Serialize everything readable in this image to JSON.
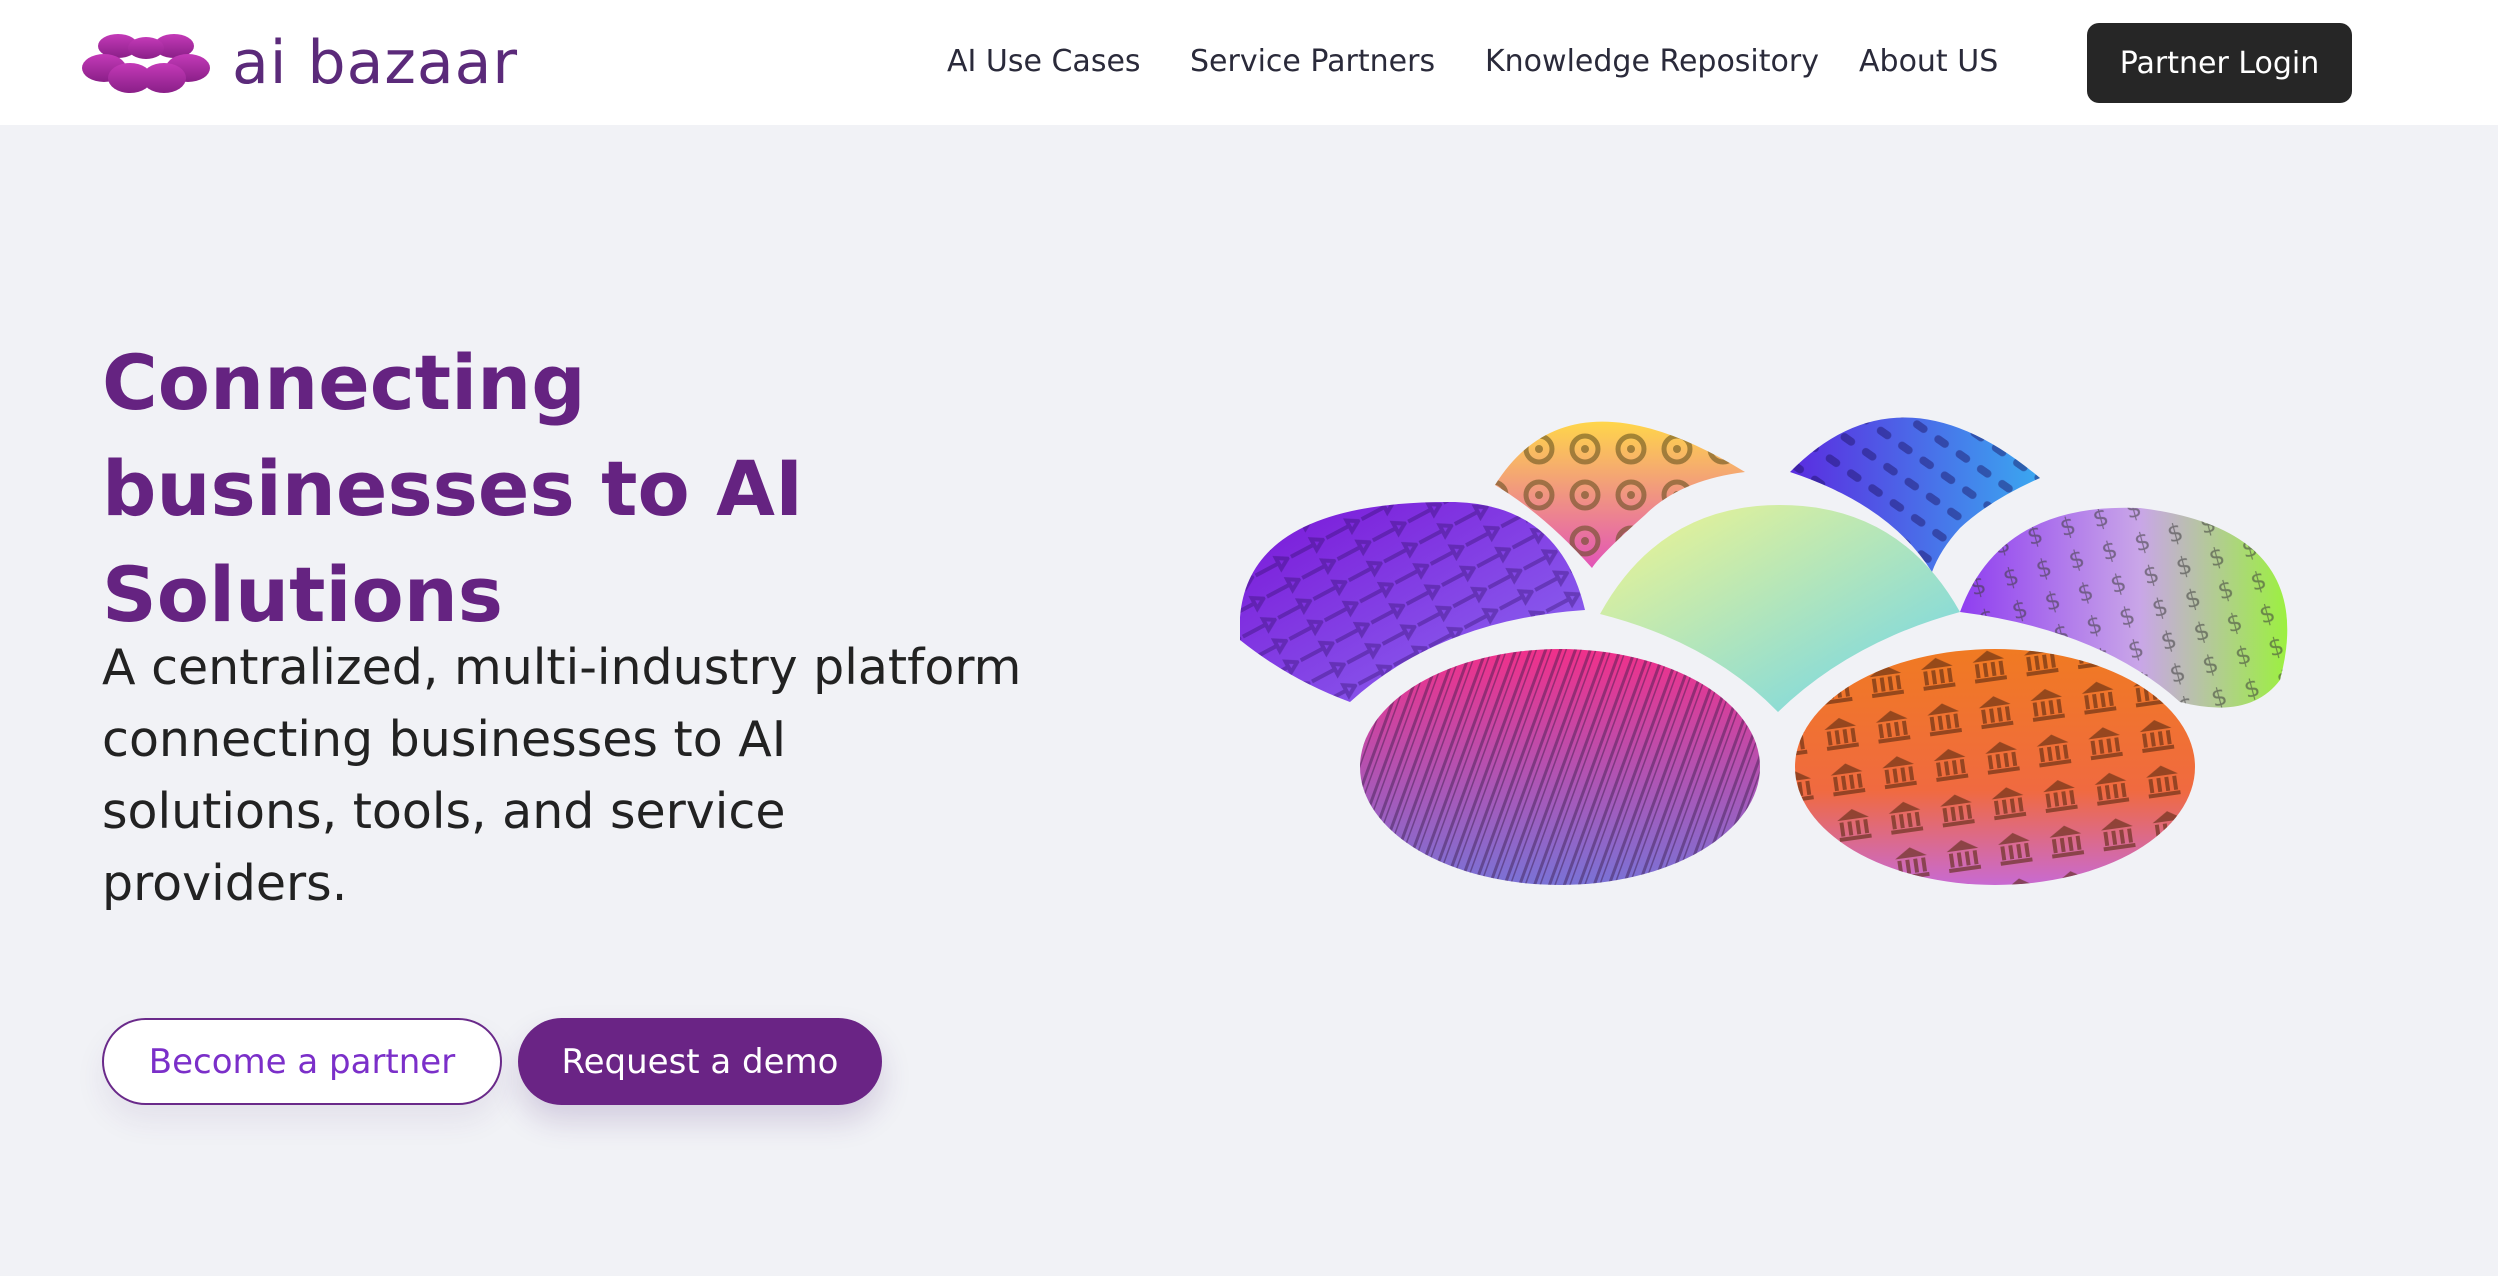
{
  "brand": {
    "name": "ai bazaar",
    "color": "#652381"
  },
  "nav": {
    "items": [
      {
        "label": "AI Use Cases"
      },
      {
        "label": "Service Partners"
      },
      {
        "label": "Knowledge Repository"
      },
      {
        "label": "About US"
      }
    ],
    "login_label": "Partner Login"
  },
  "hero": {
    "title": "Connecting businesses to AI Solutions",
    "subtitle": "A centralized, multi-industry platform connecting businesses to AI solutions, tools, and service providers.",
    "primary_cta": "Become a partner",
    "secondary_cta": "Request a demo"
  },
  "illustration": {
    "icon": "ai-bazaar-petal-cluster",
    "petals": [
      "gears",
      "pills",
      "logistics-trucks",
      "currency-symbols",
      "center-gradient",
      "barcodes",
      "bank-buildings"
    ]
  },
  "colors": {
    "accent": "#652381",
    "accent_dark_button": "#262626",
    "page_bg": "#f1f2f6",
    "link_purple": "#7b2fc9"
  }
}
